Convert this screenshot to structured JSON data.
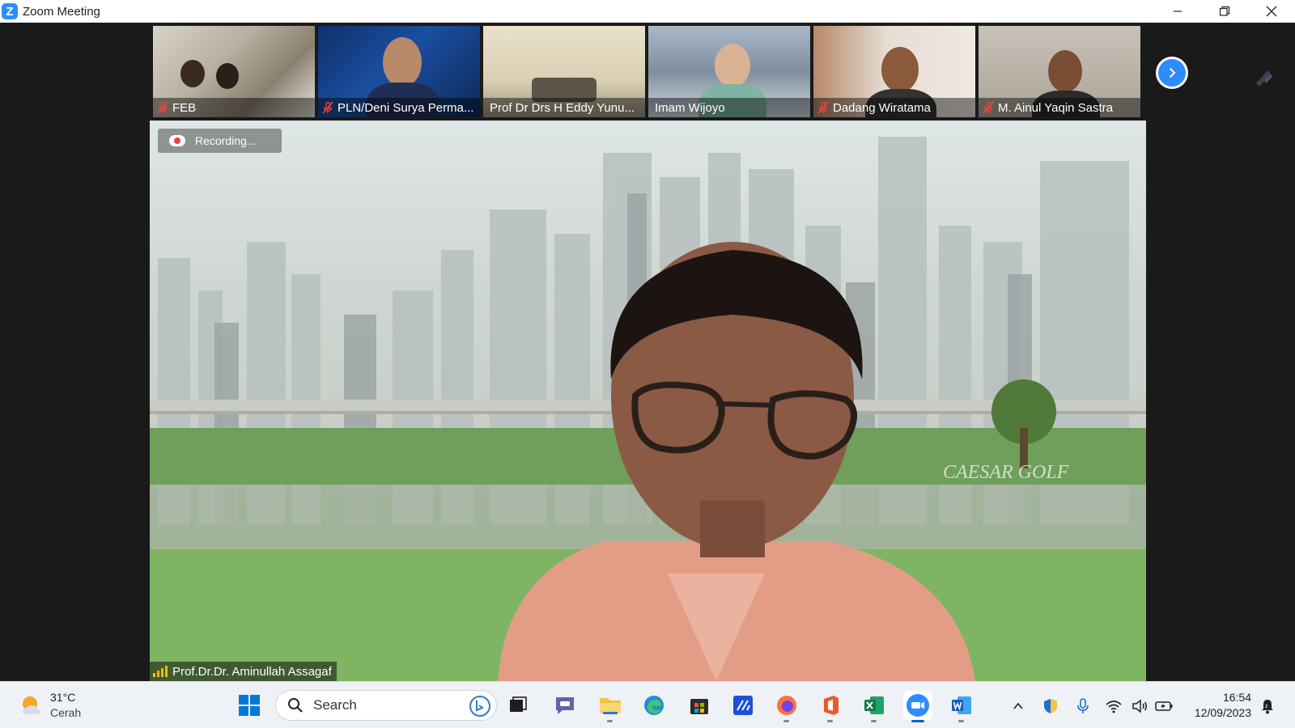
{
  "window": {
    "title": "Zoom Meeting"
  },
  "gallery": {
    "participants": [
      {
        "name": "FEB",
        "muted": true
      },
      {
        "name": "PLN/Deni Surya Perma...",
        "muted": true
      },
      {
        "name": "Prof Dr  Drs H Eddy Yunu...",
        "muted": false
      },
      {
        "name": "Imam Wijoyo",
        "muted": false
      },
      {
        "name": "Dadang Wiratama",
        "muted": true
      },
      {
        "name": "M. Ainul Yaqin Sastra",
        "muted": true
      }
    ],
    "next_icon": "chevron-right-icon"
  },
  "main": {
    "recording_label": "Recording...",
    "speaker_name": "Prof.Dr.Dr. Aminullah Assagaf",
    "background_text": "CAESAR GOLF"
  },
  "taskbar": {
    "weather": {
      "temp": "31°C",
      "desc": "Cerah"
    },
    "search_label": "Search",
    "clock": {
      "time": "16:54",
      "date": "12/09/2023"
    }
  },
  "colors": {
    "zoom_blue": "#2d8cff",
    "mute_red": "#e8473d",
    "taskbar_bg": "#eef1f6"
  }
}
